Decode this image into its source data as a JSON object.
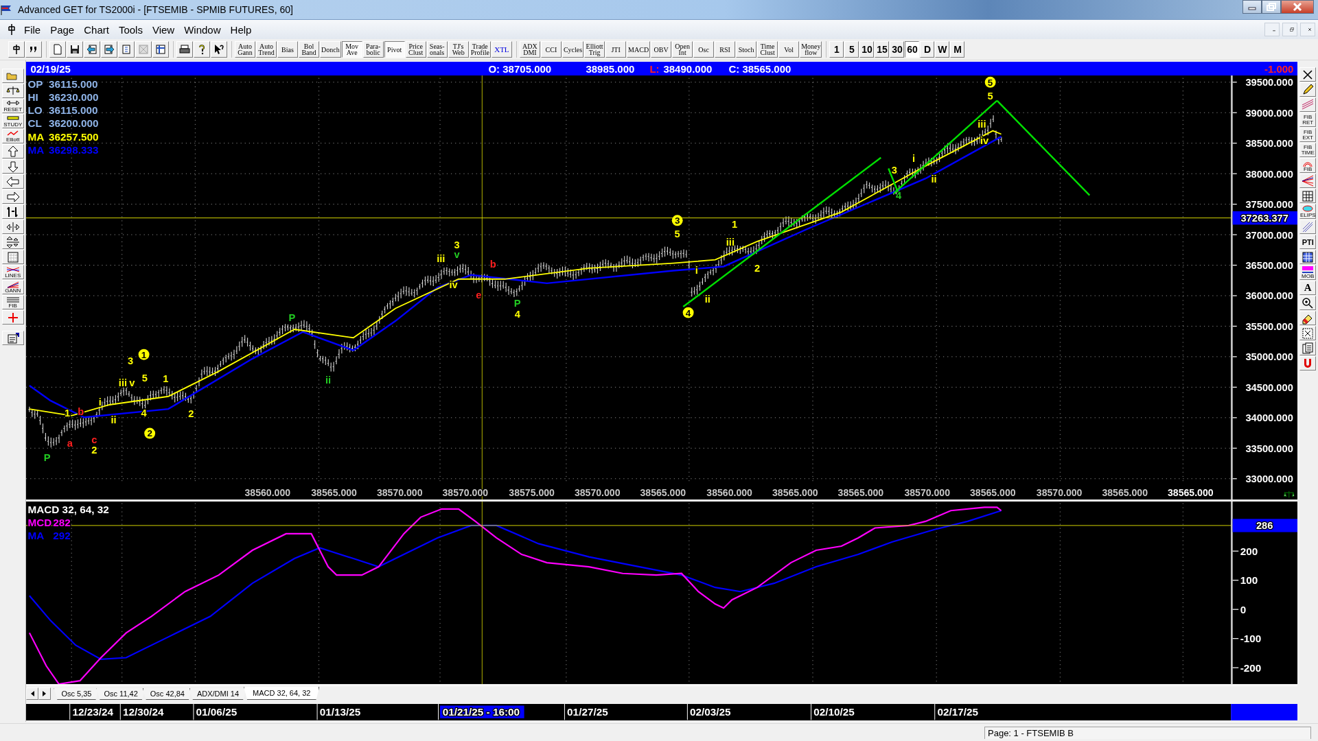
{
  "window": {
    "title": "Advanced GET for TS2000i - [FTSEMIB - SPMIB FUTURES, 60]"
  },
  "menu": [
    "File",
    "Page",
    "Chart",
    "Tools",
    "View",
    "Window",
    "Help"
  ],
  "indicator_buttons": [
    {
      "label": "Auto\nGann",
      "pressed": false
    },
    {
      "label": "Auto\nTrend",
      "pressed": false
    },
    {
      "label": "Bias",
      "pressed": false
    },
    {
      "label": "Bol\nBand",
      "pressed": false
    },
    {
      "label": "Donch",
      "pressed": false
    },
    {
      "label": "Mov\nAve",
      "pressed": true
    },
    {
      "label": "Para-\nbolic",
      "pressed": false
    },
    {
      "label": "Pivot",
      "pressed": true
    },
    {
      "label": "Price\nClust",
      "pressed": false
    },
    {
      "label": "Seas-\nonals",
      "pressed": false
    },
    {
      "label": "TJ's\nWeb",
      "pressed": false
    },
    {
      "label": "Trade\nProfile",
      "pressed": false
    },
    {
      "label": "XTL",
      "pressed": false
    }
  ],
  "study_buttons": [
    {
      "label": "ADX\nDMI",
      "pressed": false
    },
    {
      "label": "CCI",
      "pressed": false
    },
    {
      "label": "Cycles",
      "pressed": false
    },
    {
      "label": "Elliott\nTrig",
      "pressed": false
    },
    {
      "label": "JTI",
      "pressed": false
    },
    {
      "label": "MACD",
      "pressed": false
    },
    {
      "label": "OBV",
      "pressed": false
    },
    {
      "label": "Open\nInt",
      "pressed": false
    },
    {
      "label": "Osc",
      "pressed": false
    },
    {
      "label": "RSI",
      "pressed": false
    },
    {
      "label": "Stoch",
      "pressed": false
    },
    {
      "label": "Time\nClust",
      "pressed": false
    },
    {
      "label": "Vol",
      "pressed": false
    },
    {
      "label": "Money\nflow",
      "pressed": false
    }
  ],
  "interval_buttons": [
    {
      "label": "1",
      "selected": false
    },
    {
      "label": "5",
      "selected": false
    },
    {
      "label": "10",
      "selected": false
    },
    {
      "label": "15",
      "selected": false
    },
    {
      "label": "30",
      "selected": false
    },
    {
      "label": "60",
      "selected": true
    },
    {
      "label": "D",
      "selected": false
    },
    {
      "label": "W",
      "selected": false
    },
    {
      "label": "M",
      "selected": false
    }
  ],
  "info_bar": {
    "date": "02/19/25",
    "open": "O: 38705.000",
    "high": "38985.000",
    "low_label": "L:",
    "low": "38490.000",
    "close": "C: 38565.000",
    "change": "-1.000"
  },
  "left_tool_labels": [
    "RESET",
    "STUDY",
    "Elliott",
    "LINES",
    "GANN",
    "FIB"
  ],
  "right_tool_labels": [
    "FIB\nRET",
    "FIB\nEXT",
    "FIB\nTIME",
    "FIB",
    "ELIPS",
    "PTI",
    "MOB",
    "A"
  ],
  "price_legend": [
    {
      "label": "OP",
      "value": "36115.000",
      "color": "#8fb4e8"
    },
    {
      "label": "HI",
      "value": "36230.000",
      "color": "#8fb4e8"
    },
    {
      "label": "LO",
      "value": "36115.000",
      "color": "#8fb4e8"
    },
    {
      "label": "CL",
      "value": "36200.000",
      "color": "#8fb4e8"
    },
    {
      "label": "MA",
      "value": "36257.500",
      "color": "#ffff00"
    },
    {
      "label": "MA",
      "value": "36298.333",
      "color": "#0000ff"
    }
  ],
  "price_axis": [
    "39500.000",
    "39000.000",
    "38500.000",
    "38000.000",
    "37500.000",
    "37000.000",
    "36500.000",
    "36000.000",
    "35500.000",
    "35000.000",
    "34500.000",
    "34000.000",
    "33500.000",
    "33000.000"
  ],
  "crosshair_price": "37263.377",
  "bottom_values": [
    "38560.000",
    "38565.000",
    "38570.000",
    "38570.000",
    "38575.000",
    "38570.000",
    "38565.000",
    "38560.000",
    "38565.000",
    "38565.000",
    "38570.000",
    "38565.000",
    "38570.000",
    "38565.000",
    "38565.000"
  ],
  "wave_labels": [
    {
      "text": "P",
      "color": "#22cc22",
      "circled": false
    },
    {
      "text": "a",
      "color": "#ff2020",
      "circled": false
    },
    {
      "text": "1",
      "color": "#ffff00",
      "circled": false
    },
    {
      "text": "b",
      "color": "#ff2020",
      "circled": false
    },
    {
      "text": "c",
      "color": "#ff2020",
      "circled": false
    },
    {
      "text": "2",
      "color": "#ffff00",
      "circled": false
    },
    {
      "text": "i",
      "color": "#ffff00",
      "circled": false
    },
    {
      "text": "ii",
      "color": "#ffff00",
      "circled": false
    },
    {
      "text": "iii",
      "color": "#ffff00",
      "circled": false
    },
    {
      "text": "v",
      "color": "#ffff00",
      "circled": false
    },
    {
      "text": "3",
      "color": "#ffff00",
      "circled": false
    },
    {
      "text": "1",
      "color": "#ffff00",
      "circled": true
    },
    {
      "text": "5",
      "color": "#ffff00",
      "circled": false
    },
    {
      "text": "4",
      "color": "#ffff00",
      "circled": false
    },
    {
      "text": "1",
      "color": "#ffff00",
      "circled": false
    },
    {
      "text": "2",
      "color": "#ffff00",
      "circled": true
    },
    {
      "text": "2",
      "color": "#ffff00",
      "circled": false
    },
    {
      "text": "P",
      "color": "#22cc22",
      "circled": false
    },
    {
      "text": "ii",
      "color": "#22cc22",
      "circled": false
    },
    {
      "text": "iii",
      "color": "#ffff00",
      "circled": false
    },
    {
      "text": "3",
      "color": "#ffff00",
      "circled": false
    },
    {
      "text": "v",
      "color": "#22cc22",
      "circled": false
    },
    {
      "text": "iv",
      "color": "#ffff00",
      "circled": false
    },
    {
      "text": "b",
      "color": "#ff2020",
      "circled": false
    },
    {
      "text": "e",
      "color": "#ff2020",
      "circled": false
    },
    {
      "text": "P",
      "color": "#22cc22",
      "circled": false
    },
    {
      "text": "4",
      "color": "#ffff00",
      "circled": false
    },
    {
      "text": "3",
      "color": "#ffff00",
      "circled": true
    },
    {
      "text": "5",
      "color": "#ffff00",
      "circled": false
    },
    {
      "text": "i",
      "color": "#ffff00",
      "circled": false
    },
    {
      "text": "ii",
      "color": "#ffff00",
      "circled": false
    },
    {
      "text": "4",
      "color": "#ffff00",
      "circled": true
    },
    {
      "text": "1",
      "color": "#ffff00",
      "circled": false
    },
    {
      "text": "iii",
      "color": "#ffff00",
      "circled": false
    },
    {
      "text": "2",
      "color": "#ffff00",
      "circled": false
    },
    {
      "text": "3",
      "color": "#ffff00",
      "circled": false
    },
    {
      "text": "4",
      "color": "#22cc22",
      "circled": false
    },
    {
      "text": "i",
      "color": "#ffff00",
      "circled": false
    },
    {
      "text": "ii",
      "color": "#ffff00",
      "circled": false
    },
    {
      "text": "5",
      "color": "#ffff00",
      "circled": true
    },
    {
      "text": "5",
      "color": "#ffff00",
      "circled": false
    },
    {
      "text": "iii",
      "color": "#ffff00",
      "circled": false
    },
    {
      "text": "iv",
      "color": "#ffff00",
      "circled": false
    }
  ],
  "macd": {
    "title": "MACD 32, 64, 32",
    "legend": [
      {
        "label": "MCD",
        "value": "282",
        "color": "#ff00ff"
      },
      {
        "label": "MA",
        "value": "292",
        "color": "#0000ff"
      }
    ],
    "axis": [
      "200",
      "100",
      "0",
      "-100",
      "-200"
    ],
    "crosshair_value": "286"
  },
  "tabs": [
    {
      "label": "Osc 5,35",
      "selected": false
    },
    {
      "label": "Osc 11,42",
      "selected": false
    },
    {
      "label": "Osc 42,84",
      "selected": false
    },
    {
      "label": "ADX/DMI 14",
      "selected": false
    },
    {
      "label": "MACD 32, 64, 32",
      "selected": true
    }
  ],
  "dates": [
    {
      "label": "12/23/24",
      "selected": false
    },
    {
      "label": "12/30/24",
      "selected": false
    },
    {
      "label": "01/06/25",
      "selected": false
    },
    {
      "label": "01/13/25",
      "selected": false
    },
    {
      "label": "01/21/25 - 16:00",
      "selected": true
    },
    {
      "label": "01/27/25",
      "selected": false
    },
    {
      "label": "02/03/25",
      "selected": false
    },
    {
      "label": "02/10/25",
      "selected": false
    },
    {
      "label": "02/17/25",
      "selected": false
    }
  ],
  "status": "Page: 1 - FTSEMIB B"
}
